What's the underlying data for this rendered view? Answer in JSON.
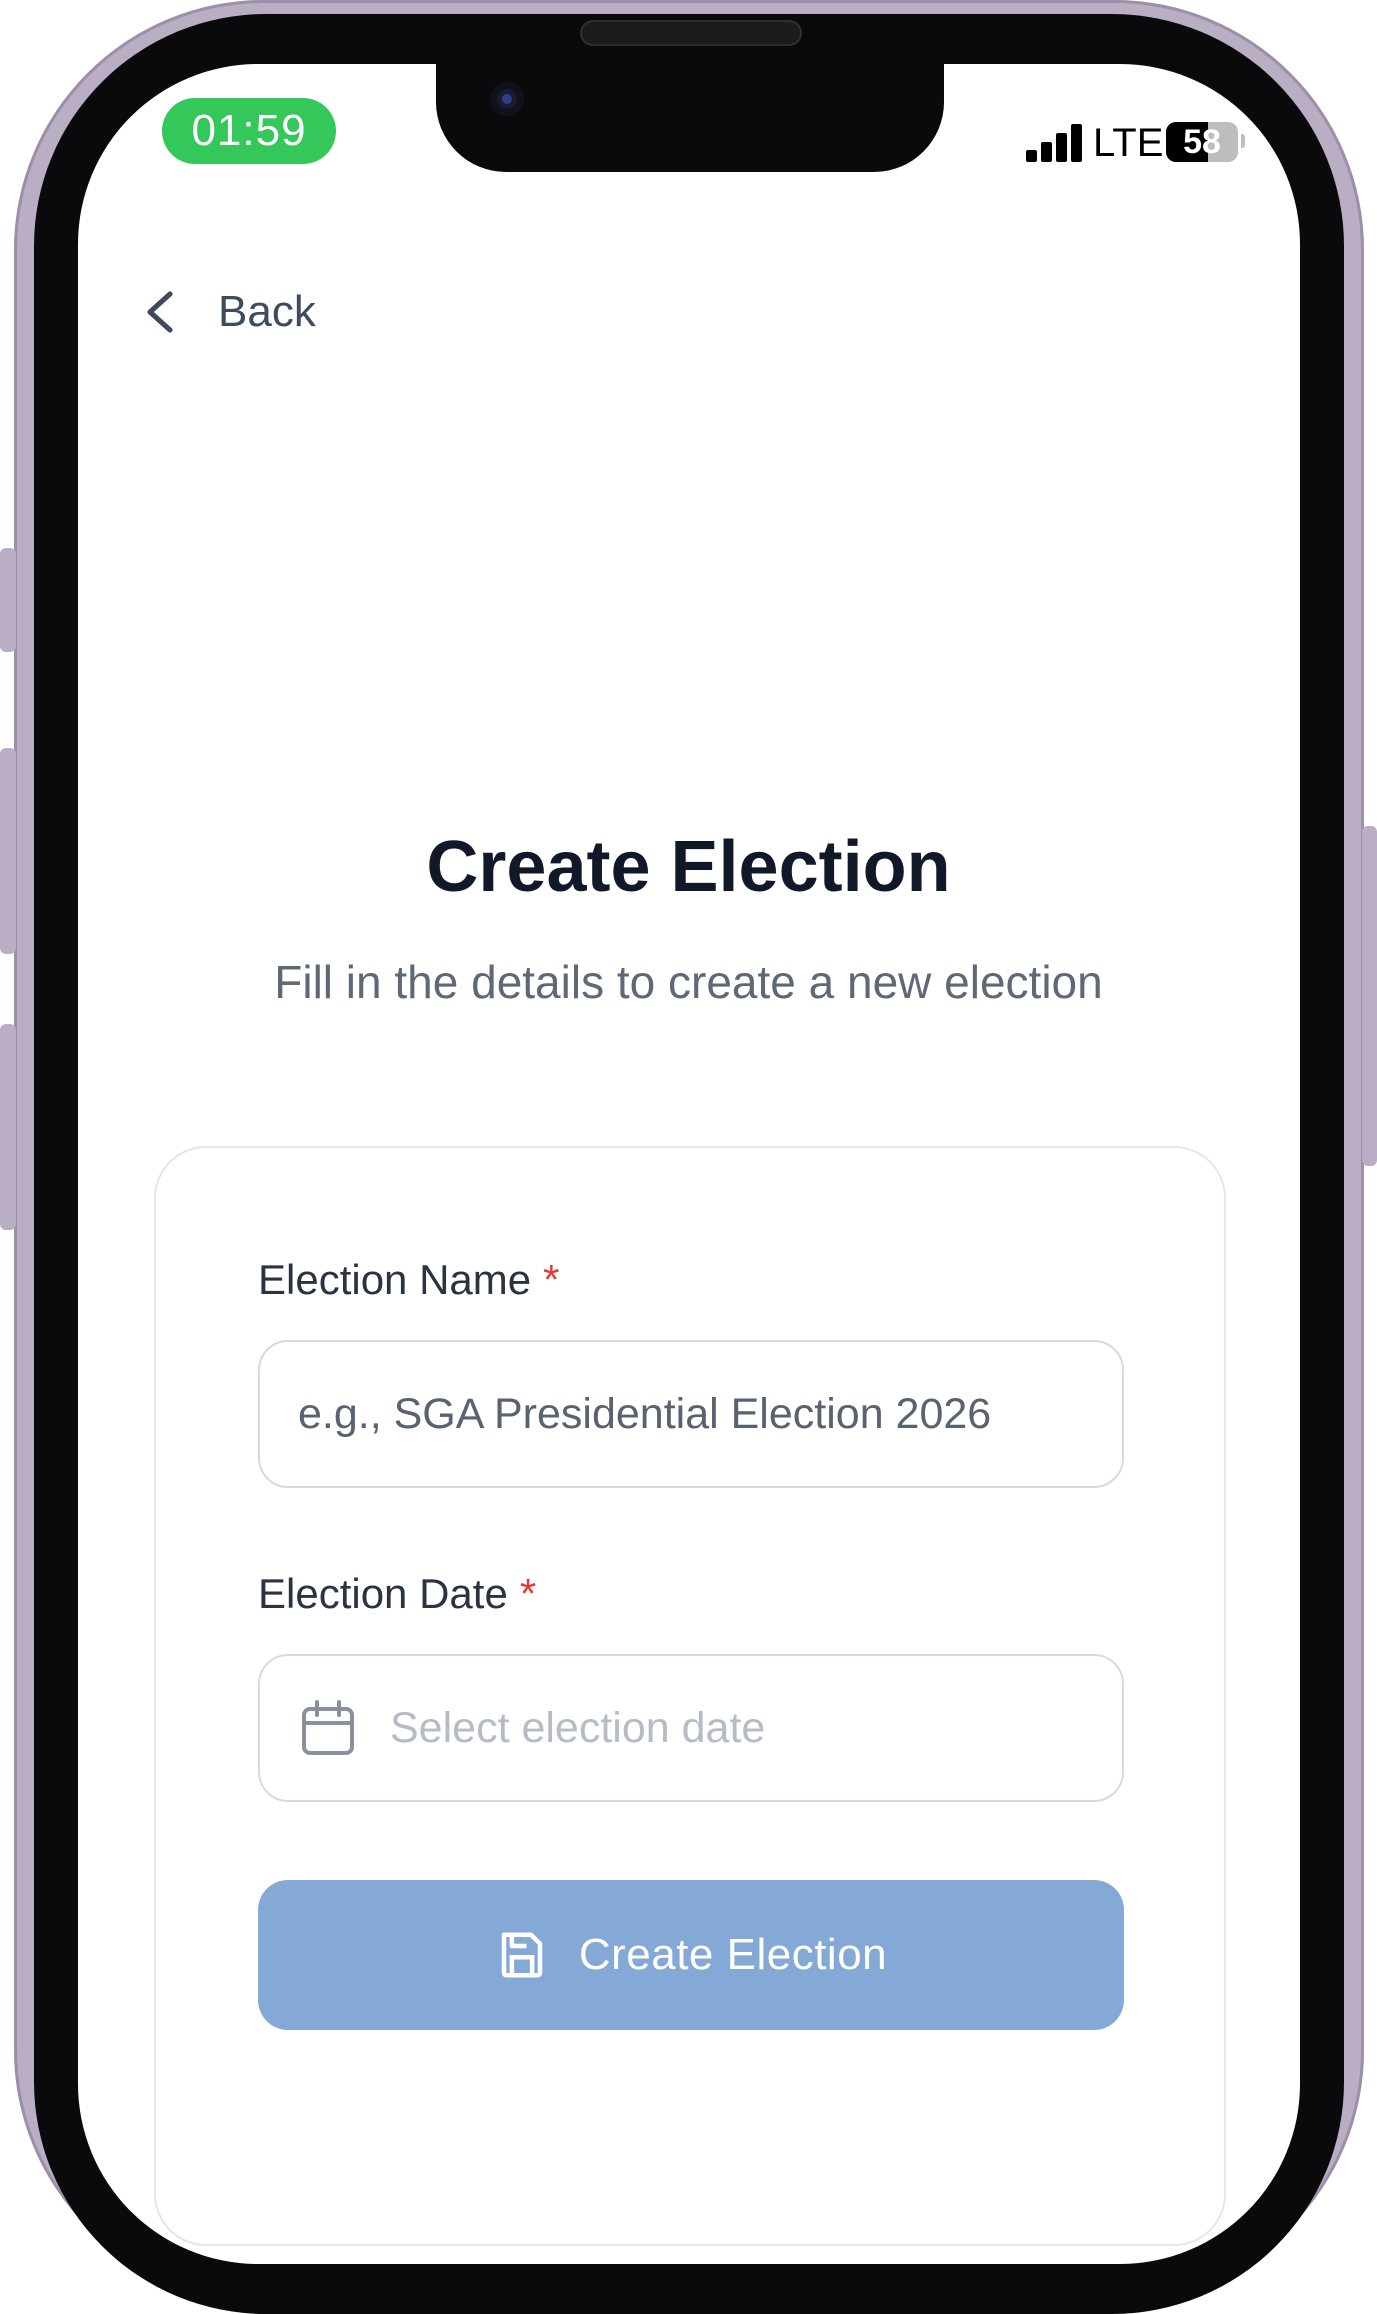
{
  "status_bar": {
    "time": "01:59",
    "network": "LTE",
    "battery_level": "58",
    "time_pill_color": "#34c759"
  },
  "nav": {
    "back_label": "Back",
    "back_icon": "chevron-left-icon"
  },
  "header": {
    "title": "Create Election",
    "subtitle": "Fill in the details to create a new election"
  },
  "form": {
    "election_name": {
      "label": "Election Name",
      "required_marker": "*",
      "placeholder": "e.g., SGA Presidential Election 2026",
      "value": ""
    },
    "election_date": {
      "label": "Election Date",
      "required_marker": "*",
      "placeholder": "Select election date",
      "icon": "calendar-icon"
    },
    "submit": {
      "label": "Create Election",
      "icon": "save-icon",
      "color": "#84a9d6"
    }
  }
}
